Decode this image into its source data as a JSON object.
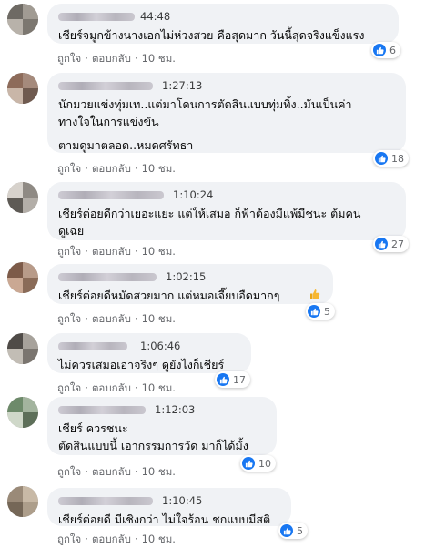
{
  "comments": [
    {
      "time": "44:48",
      "lines": [
        "เชียร์จมูกข้างนางเอกไม่ห่วงสวย คือสุดมาก วันนี้สุดจริงแข็งแรง"
      ],
      "like": "ถูกใจ",
      "reply": "ตอบกลับ",
      "age": "10 ชม.",
      "reactions": "6"
    },
    {
      "time": "1:27:13",
      "lines": [
        "นักมวยแข่งทุ่มเท..แต่มาโดนการตัดสินแบบทุ่มทิ้ง..มันเป็นค่า",
        "ทางใจในการแข่งขัน",
        "ตามดูมาตลอด..หมดศรัทธา"
      ],
      "like": "ถูกใจ",
      "reply": "ตอบกลับ",
      "age": "10 ชม.",
      "reactions": "18"
    },
    {
      "time": "1:10:24",
      "lines": [
        "เชียร์ต่อยดีกว่าเยอะแยะ แต่ให้เสมอ ก็ฟ้าต้องมีแพ้มีชนะ ต้มคน",
        "ดูเฉย"
      ],
      "like": "ถูกใจ",
      "reply": "ตอบกลับ",
      "age": "10 ชม.",
      "reactions": "27"
    },
    {
      "time": "1:02:15",
      "lines": [
        "เชียร์ต่อยดีหมัดสวยมาก แต่หมอเจี๊ยบอืดมากๆ"
      ],
      "like": "ถูกใจ",
      "reply": "ตอบกลับ",
      "age": "10 ชม.",
      "reactions": "5"
    },
    {
      "time": "1:06:46",
      "lines": [
        "ไม่ควรเสมอเอาจริงๆ ดูยังไงก็เชียร์"
      ],
      "like": "ถูกใจ",
      "reply": "ตอบกลับ",
      "age": "10 ชม.",
      "reactions": "17"
    },
    {
      "time": "1:12:03",
      "lines": [
        "เชียร์ ควรชนะ",
        "ตัดสินแบบนี้ เอากรรมการวัด มาก็ได้มั้ง"
      ],
      "like": "ถูกใจ",
      "reply": "ตอบกลับ",
      "age": "10 ชม.",
      "reactions": "10"
    },
    {
      "time": "1:10:45",
      "lines": [
        "เชียร์ต่อยดี มีเชิงกว่า ไม่ใจร้อน ชกแบบมีสติ"
      ],
      "like": "ถูกใจ",
      "reply": "ตอบกลับ",
      "age": "10 ชม.",
      "reactions": "5"
    }
  ],
  "colors": {
    "bubble": "#f0f2f5",
    "like_blue": "#1877f2",
    "meta": "#65676b"
  },
  "icons": {
    "reaction": "like-icon",
    "emoji": "thumbs-up-emoji"
  }
}
